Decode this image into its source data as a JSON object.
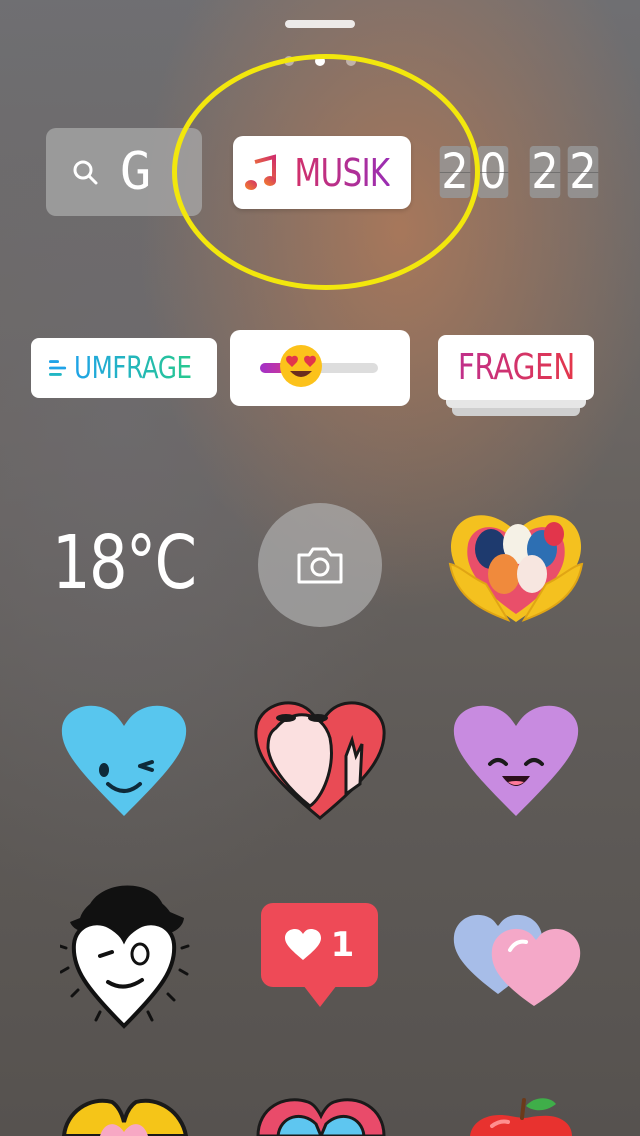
{
  "sheet": {
    "active_page": 2,
    "page_count": 3
  },
  "stickers": {
    "search": {
      "label": "G"
    },
    "music": {
      "label": "MUSIK"
    },
    "year": {
      "digits": [
        "2",
        "0",
        "2",
        "2"
      ]
    },
    "poll": {
      "label": "UMFRAGE"
    },
    "emoji_slider": {
      "value": 0.35,
      "emoji": "heart-eyes"
    },
    "questions": {
      "label": "FRAGEN"
    },
    "temperature": {
      "value": "18°C"
    },
    "camera": {
      "icon": "camera-icon"
    },
    "like_notification": {
      "count": "1"
    }
  },
  "colors": {
    "highlight": "#f2e70d",
    "music_gradient": [
      "#d1306a",
      "#9a2eb3"
    ],
    "poll_gradient": [
      "#1fa3e8",
      "#28c98e"
    ],
    "questions_gradient": [
      "#c02f8b",
      "#e4374a"
    ],
    "like_red": "#ee4a57"
  },
  "icons": [
    "search-icon",
    "music-note-icon",
    "poll-bars-icon",
    "camera-icon",
    "heart-icon",
    "easter-eggs-heart-icon",
    "blue-winking-heart-icon",
    "red-heart-character-icon",
    "purple-smiling-heart-icon",
    "hat-heart-character-icon",
    "two-hearts-icon",
    "yellow-hands-heart-icon",
    "butterfly-heart-icon",
    "apple-icon"
  ]
}
